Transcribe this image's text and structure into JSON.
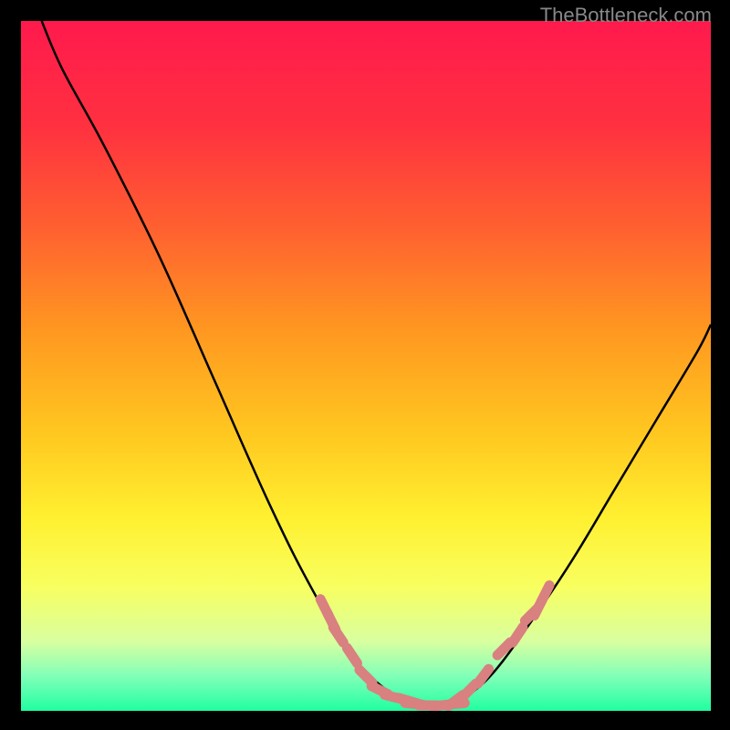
{
  "watermark": "TheBottleneck.com",
  "chart_data": {
    "type": "line",
    "title": "",
    "xlabel": "",
    "ylabel": "",
    "xlim": [
      0,
      100
    ],
    "ylim": [
      0,
      100
    ],
    "background_gradient": {
      "stops": [
        {
          "offset": 0,
          "color": "#ff1a4d"
        },
        {
          "offset": 15,
          "color": "#ff3040"
        },
        {
          "offset": 30,
          "color": "#ff6030"
        },
        {
          "offset": 45,
          "color": "#ff9820"
        },
        {
          "offset": 60,
          "color": "#ffc820"
        },
        {
          "offset": 72,
          "color": "#fff030"
        },
        {
          "offset": 82,
          "color": "#f8ff60"
        },
        {
          "offset": 90,
          "color": "#d8ffa0"
        },
        {
          "offset": 95,
          "color": "#80ffb8"
        },
        {
          "offset": 100,
          "color": "#20ffa0"
        }
      ]
    },
    "series": [
      {
        "name": "left_curve",
        "type": "smooth",
        "color": "#000000",
        "points": [
          {
            "x": 3,
            "y": 100
          },
          {
            "x": 6,
            "y": 93
          },
          {
            "x": 12,
            "y": 82
          },
          {
            "x": 20,
            "y": 66
          },
          {
            "x": 28,
            "y": 48
          },
          {
            "x": 36,
            "y": 30
          },
          {
            "x": 42,
            "y": 18
          },
          {
            "x": 48,
            "y": 8
          },
          {
            "x": 53,
            "y": 3
          },
          {
            "x": 57,
            "y": 1
          }
        ]
      },
      {
        "name": "right_curve",
        "type": "smooth",
        "color": "#000000",
        "points": [
          {
            "x": 63,
            "y": 1
          },
          {
            "x": 68,
            "y": 5
          },
          {
            "x": 74,
            "y": 13
          },
          {
            "x": 80,
            "y": 22
          },
          {
            "x": 86,
            "y": 32
          },
          {
            "x": 92,
            "y": 42
          },
          {
            "x": 98,
            "y": 52
          },
          {
            "x": 100,
            "y": 56
          }
        ]
      },
      {
        "name": "left_markers",
        "type": "markers",
        "color": "#d98080",
        "points": [
          {
            "x": 44,
            "y": 15
          },
          {
            "x": 45,
            "y": 13
          },
          {
            "x": 46,
            "y": 11
          },
          {
            "x": 48,
            "y": 8
          },
          {
            "x": 50,
            "y": 5
          },
          {
            "x": 52,
            "y": 3
          },
          {
            "x": 54,
            "y": 2
          },
          {
            "x": 56,
            "y": 1.5
          },
          {
            "x": 57,
            "y": 1.2
          }
        ]
      },
      {
        "name": "right_markers",
        "type": "markers",
        "color": "#d98080",
        "points": [
          {
            "x": 63,
            "y": 1.5
          },
          {
            "x": 65,
            "y": 3
          },
          {
            "x": 67,
            "y": 5
          },
          {
            "x": 70,
            "y": 9
          },
          {
            "x": 72,
            "y": 11
          },
          {
            "x": 74,
            "y": 14
          },
          {
            "x": 75,
            "y": 15
          },
          {
            "x": 76,
            "y": 17
          }
        ]
      },
      {
        "name": "bottom_markers",
        "type": "markers",
        "color": "#d98080",
        "points": [
          {
            "x": 57,
            "y": 1
          },
          {
            "x": 59,
            "y": 0.8
          },
          {
            "x": 61,
            "y": 0.8
          },
          {
            "x": 63,
            "y": 1
          }
        ]
      }
    ]
  }
}
